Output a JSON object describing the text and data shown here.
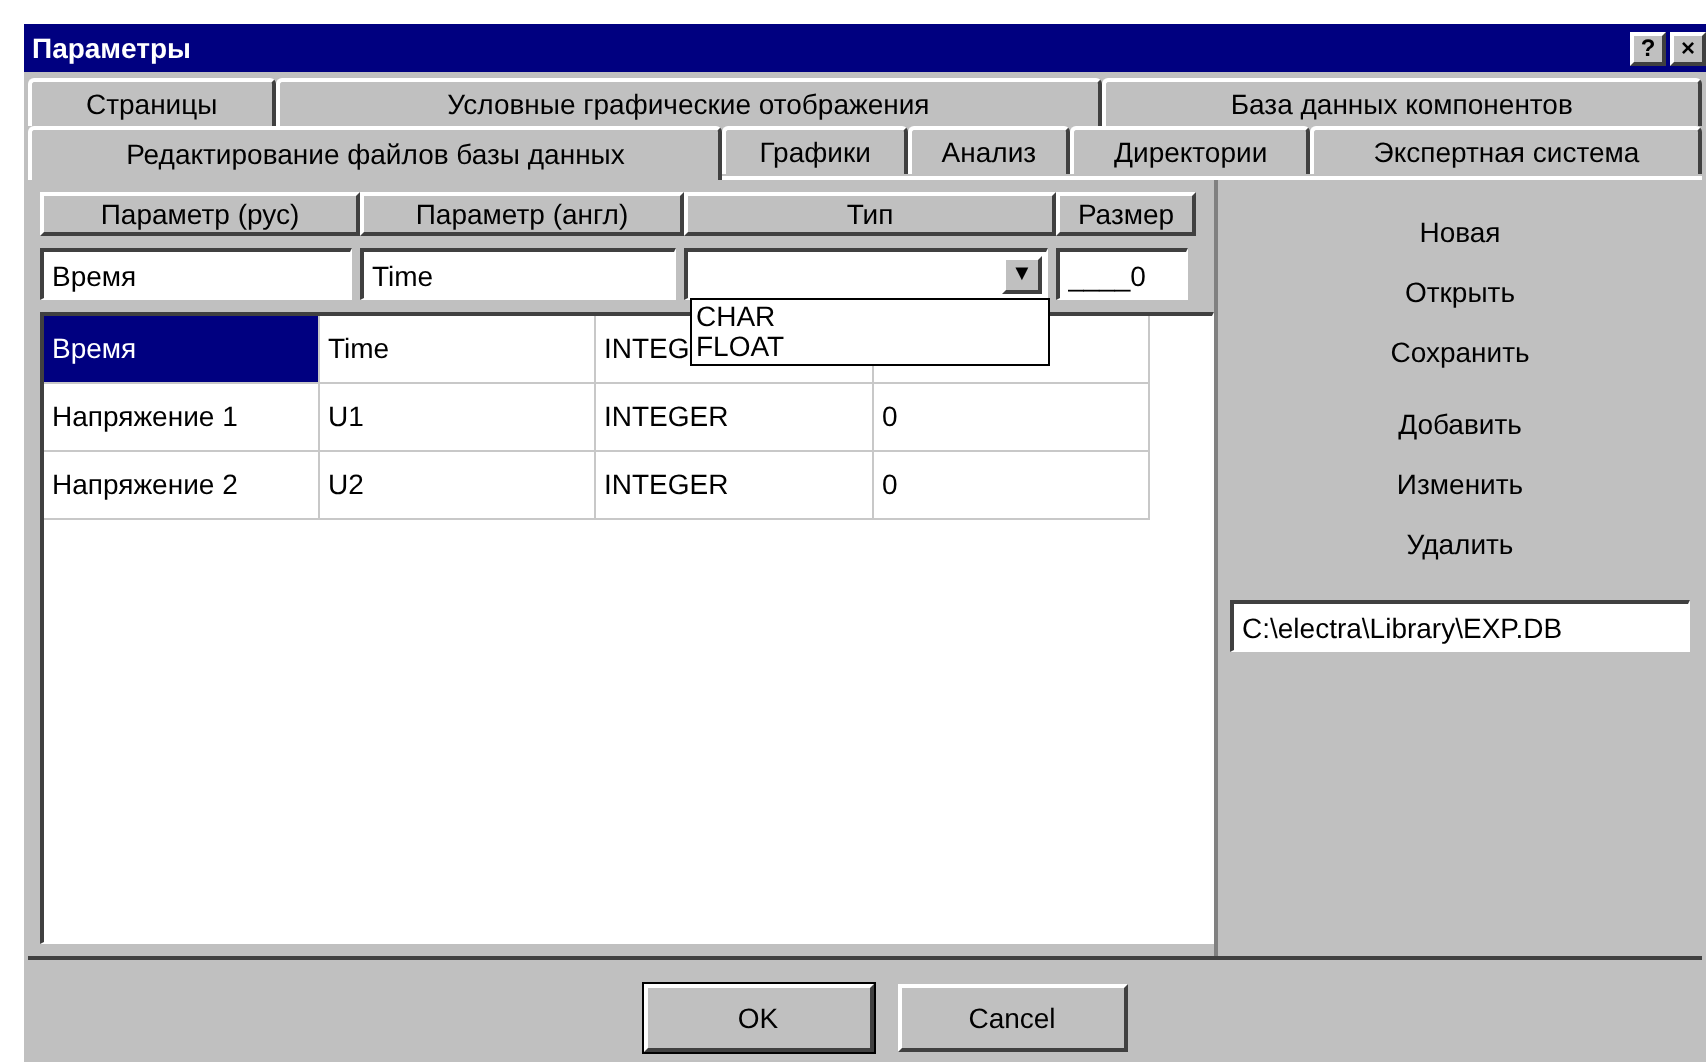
{
  "window": {
    "title": "Параметры",
    "title_buttons": [
      "?",
      "×"
    ]
  },
  "tab_rows": [
    [
      {
        "label": "Страницы",
        "selected": false
      },
      {
        "label": "Условные графические отображения",
        "selected": false
      },
      {
        "label": "База данных компонентов",
        "selected": false
      }
    ],
    [
      {
        "label": "Редактирование файлов базы данных",
        "selected": true
      },
      {
        "label": "Графики",
        "selected": false
      },
      {
        "label": "Анализ",
        "selected": false
      },
      {
        "label": "Директории",
        "selected": false
      },
      {
        "label": "Экспертная система",
        "selected": false
      }
    ]
  ],
  "editor": {
    "headers": [
      "Параметр (рус)",
      "Параметр (англ)",
      "Тип",
      "Размер"
    ],
    "fields": [
      {
        "kind": "text",
        "value": "Время"
      },
      {
        "kind": "text",
        "value": "Time"
      },
      {
        "kind": "combo",
        "button": "▼"
      },
      {
        "kind": "text",
        "value": "____0"
      }
    ],
    "dropdown_options": [
      "CHAR",
      "FLOAT"
    ]
  },
  "table": {
    "rows": [
      {
        "selected": true,
        "cells": [
          "Время",
          "Time",
          "INTEG"
        ]
      },
      {
        "selected": false,
        "cells": [
          "Напряжение 1",
          "U1",
          "INTEGER",
          "0"
        ]
      },
      {
        "selected": false,
        "cells": [
          "Напряжение 2",
          "U2",
          "INTEGER",
          "0"
        ]
      }
    ]
  },
  "side_actions": [
    [
      "Новая",
      "Открыть",
      "Сохранить"
    ],
    [
      "Добавить",
      "Изменить",
      "Удалить"
    ]
  ],
  "path_field": {
    "value": "C:\\electra\\Library\\EXP.DB"
  },
  "buttons": [
    {
      "label": "OK",
      "default": true
    },
    {
      "label": "Cancel",
      "default": false
    }
  ]
}
